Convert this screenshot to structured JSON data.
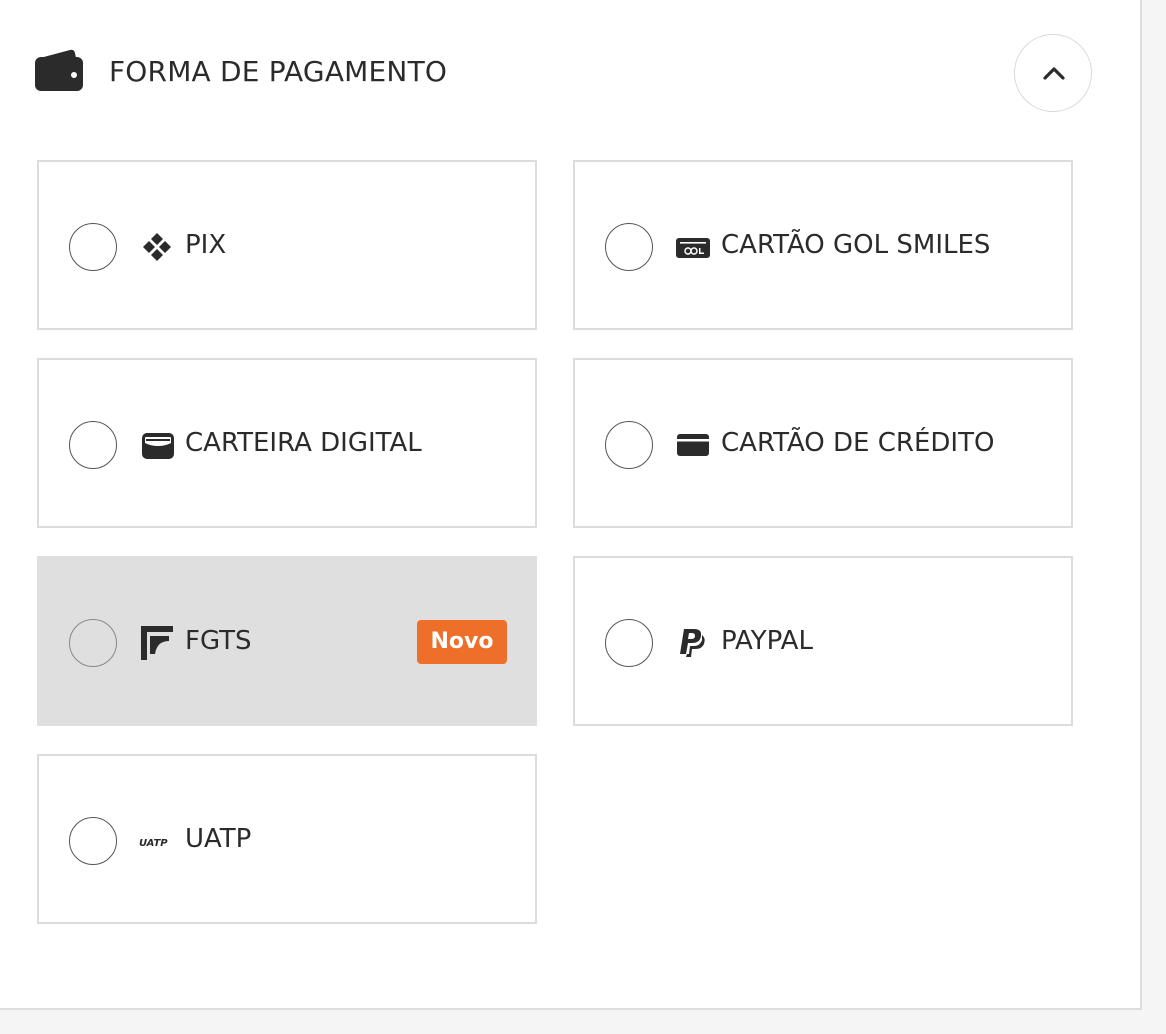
{
  "section": {
    "title": "FORMA DE PAGAMENTO",
    "header_icon": "wallet-icon",
    "collapse_icon": "chevron-up-icon"
  },
  "options": [
    {
      "label": "PIX",
      "icon": "pix-icon",
      "selected": false,
      "disabled": false
    },
    {
      "label": "CARTÃO GOL SMILES",
      "icon": "gol-card-icon",
      "selected": false,
      "disabled": false
    },
    {
      "label": "CARTEIRA DIGITAL",
      "icon": "digital-wallet-icon",
      "selected": false,
      "disabled": false
    },
    {
      "label": "CARTÃO DE CRÉDITO",
      "icon": "credit-card-icon",
      "selected": false,
      "disabled": false
    },
    {
      "label": "FGTS",
      "icon": "fgts-icon",
      "selected": false,
      "disabled": true,
      "badge": "Novo"
    },
    {
      "label": "PAYPAL",
      "icon": "paypal-icon",
      "selected": false,
      "disabled": false
    },
    {
      "label": "UATP",
      "icon": "uatp-icon",
      "icon_text": "UATP",
      "selected": false,
      "disabled": false
    }
  ],
  "colors": {
    "badge_bg": "#ee6f2a",
    "disabled_bg": "#dfdfdf",
    "text": "#2b2b2b",
    "border": "#dcdcdc"
  }
}
